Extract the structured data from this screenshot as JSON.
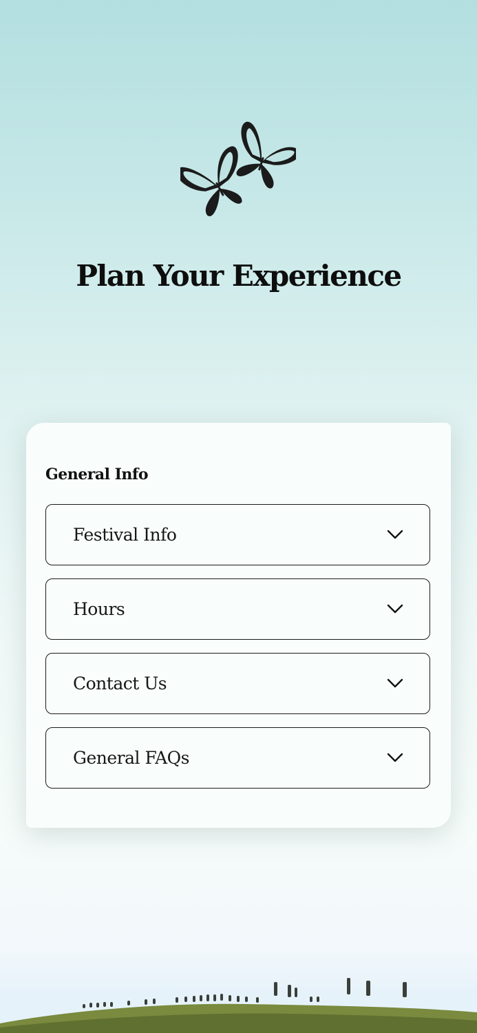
{
  "header": {
    "logo_icon": "butterflies-icon",
    "title": "Plan Your Experience"
  },
  "card": {
    "heading": "General Info",
    "items": [
      {
        "label": "Festival Info",
        "icon": "chevron-down-icon"
      },
      {
        "label": "Hours",
        "icon": "chevron-down-icon"
      },
      {
        "label": "Contact Us",
        "icon": "chevron-down-icon"
      },
      {
        "label": "General FAQs",
        "icon": "chevron-down-icon"
      }
    ]
  },
  "colors": {
    "sky_top": "#b3dfe0",
    "card_bg": "#f9fefd",
    "text": "#111111",
    "grass": "#7a8a3e"
  }
}
